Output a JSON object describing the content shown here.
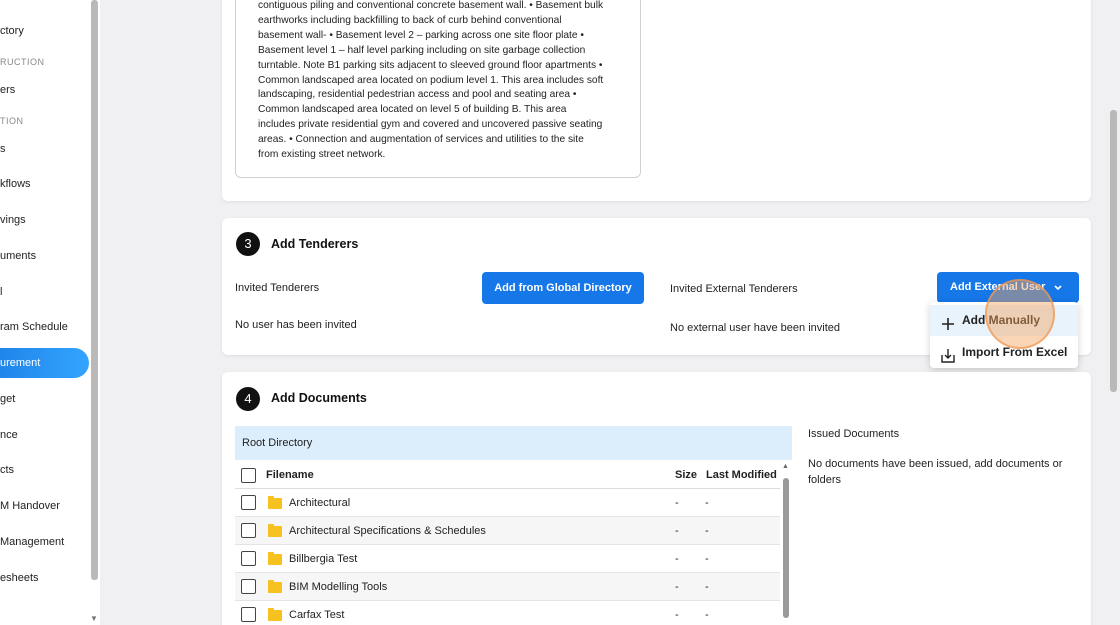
{
  "sidebar": {
    "items": [
      {
        "label": "ctory",
        "type": "item"
      },
      {
        "label": "RUCTION",
        "type": "section"
      },
      {
        "label": "ers",
        "type": "item"
      },
      {
        "label": "TION",
        "type": "section"
      },
      {
        "label": "s",
        "type": "item"
      },
      {
        "label": "kflows",
        "type": "item"
      },
      {
        "label": "vings",
        "type": "item"
      },
      {
        "label": "uments",
        "type": "item"
      },
      {
        "label": "l",
        "type": "item"
      },
      {
        "label": "ram Schedule",
        "type": "item"
      },
      {
        "label": "urement",
        "type": "active"
      },
      {
        "label": "get",
        "type": "item"
      },
      {
        "label": "nce",
        "type": "item"
      },
      {
        "label": "cts",
        "type": "item"
      },
      {
        "label": "M Handover",
        "type": "item"
      },
      {
        "label": "Management",
        "type": "item"
      },
      {
        "label": "esheets",
        "type": "item"
      }
    ]
  },
  "scope": {
    "text_lines": [
      "contiguous piling and conventional concrete basement wall. • Basement bulk",
      "earthworks including backfilling to back of curb behind conventional",
      "basement wall- • Basement level 2 – parking across one site floor plate •",
      "Basement level 1 – half level parking including on site garbage collection",
      "turntable. Note B1 parking sits adjacent to sleeved ground floor apartments •",
      "Common landscaped area located on podium level 1. This area includes soft",
      "landscaping, residential pedestrian access and pool and seating area •",
      "Common landscaped area located on level 5 of building B. This area",
      "includes private residential gym and covered and uncovered passive seating",
      "areas. • Connection and augmentation of services and utilities to the site",
      "from existing street network."
    ]
  },
  "tenderers": {
    "step": "3",
    "title": "Add Tenderers",
    "invited_label": "Invited Tenderers",
    "invited_empty": "No user has been invited",
    "add_global_label": "Add from Global Directory",
    "external_label": "Invited External Tenderers",
    "external_empty": "No external user have been invited",
    "add_external_label": "Add External User",
    "dropdown": {
      "manual_label": "Add Manually",
      "excel_label": "Import From Excel"
    }
  },
  "documents": {
    "step": "4",
    "title": "Add Documents",
    "root_label": "Root Directory",
    "columns": {
      "filename": "Filename",
      "size": "Size",
      "modified": "Last Modified"
    },
    "rows": [
      {
        "name": "Architectural",
        "size": "-",
        "modified": "-"
      },
      {
        "name": "Architectural Specifications & Schedules",
        "size": "-",
        "modified": "-"
      },
      {
        "name": "Billbergia Test",
        "size": "-",
        "modified": "-"
      },
      {
        "name": "BIM Modelling Tools",
        "size": "-",
        "modified": "-"
      },
      {
        "name": "Carfax Test",
        "size": "-",
        "modified": "-"
      }
    ],
    "issued_label": "Issued Documents",
    "issued_empty": "No documents have been issued, add documents or folders"
  }
}
